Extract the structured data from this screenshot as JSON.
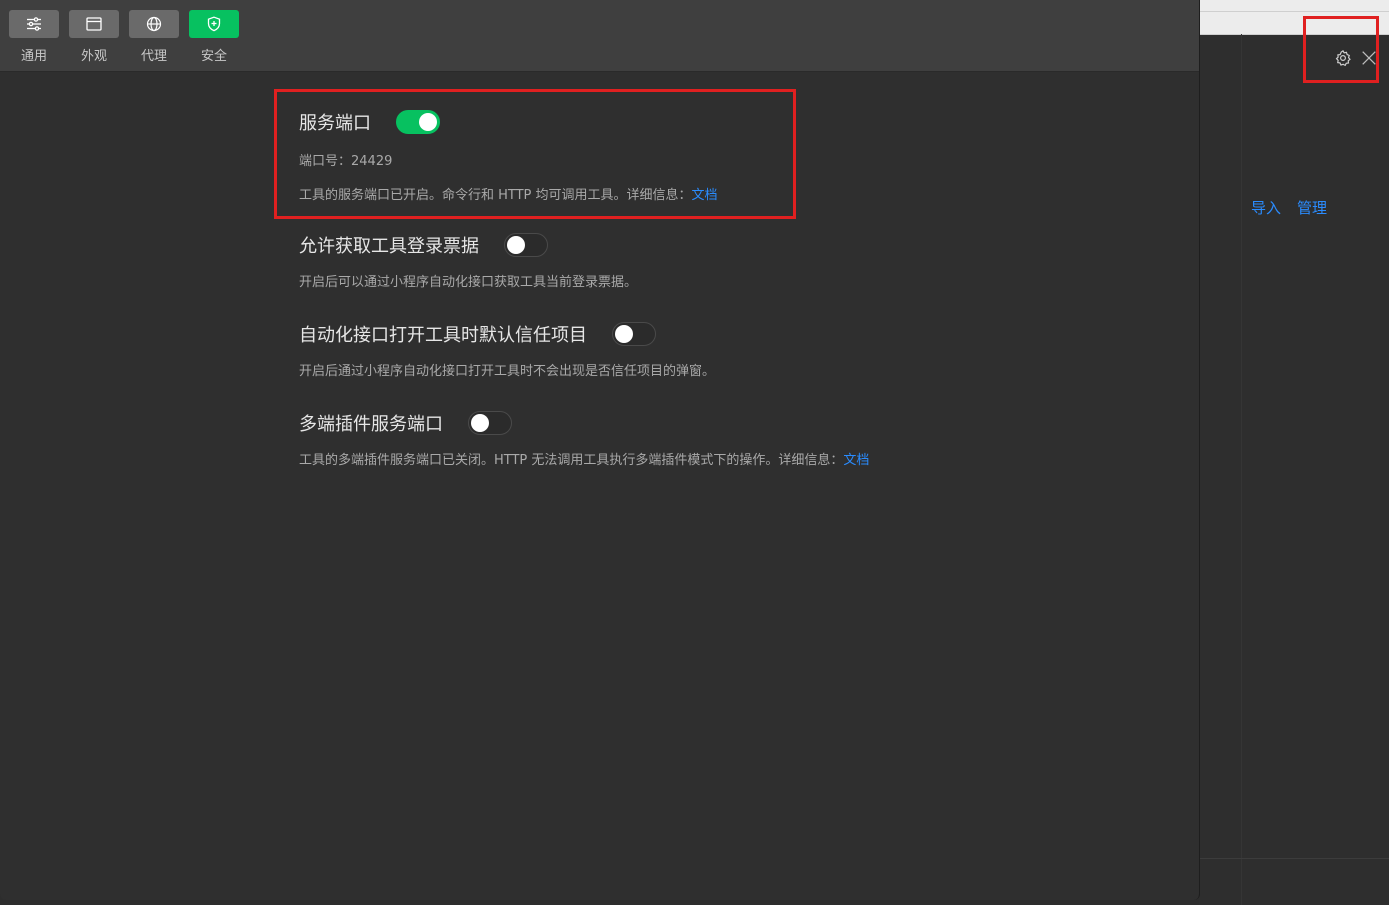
{
  "toolbar": {
    "tabs": [
      {
        "label": "通用",
        "icon": "sliders-icon",
        "active": false
      },
      {
        "label": "外观",
        "icon": "window-icon",
        "active": false
      },
      {
        "label": "代理",
        "icon": "globe-icon",
        "active": false
      },
      {
        "label": "安全",
        "icon": "shield-icon",
        "active": true
      }
    ]
  },
  "settings": {
    "service_port": {
      "title": "服务端口",
      "enabled": true,
      "port_text": "端口号：24429",
      "desc": "工具的服务端口已开启。命令行和 HTTP 均可调用工具。详细信息：",
      "link": "文档"
    },
    "login_ticket": {
      "title": "允许获取工具登录票据",
      "enabled": false,
      "desc": "开启后可以通过小程序自动化接口获取工具当前登录票据。"
    },
    "trust_project": {
      "title": "自动化接口打开工具时默认信任项目",
      "enabled": false,
      "desc": "开启后通过小程序自动化接口打开工具时不会出现是否信任项目的弹窗。"
    },
    "multi_plugin_port": {
      "title": "多端插件服务端口",
      "enabled": false,
      "desc": "工具的多端插件服务端口已关闭。HTTP 无法调用工具执行多端插件模式下的操作。详细信息：",
      "link": "文档"
    }
  },
  "background": {
    "links": [
      "导入",
      "管理"
    ],
    "icons": [
      "gear-icon",
      "close-icon"
    ]
  },
  "colors": {
    "accent_green": "#07c160",
    "link_blue": "#2a8cff",
    "highlight_red": "#e02020"
  }
}
